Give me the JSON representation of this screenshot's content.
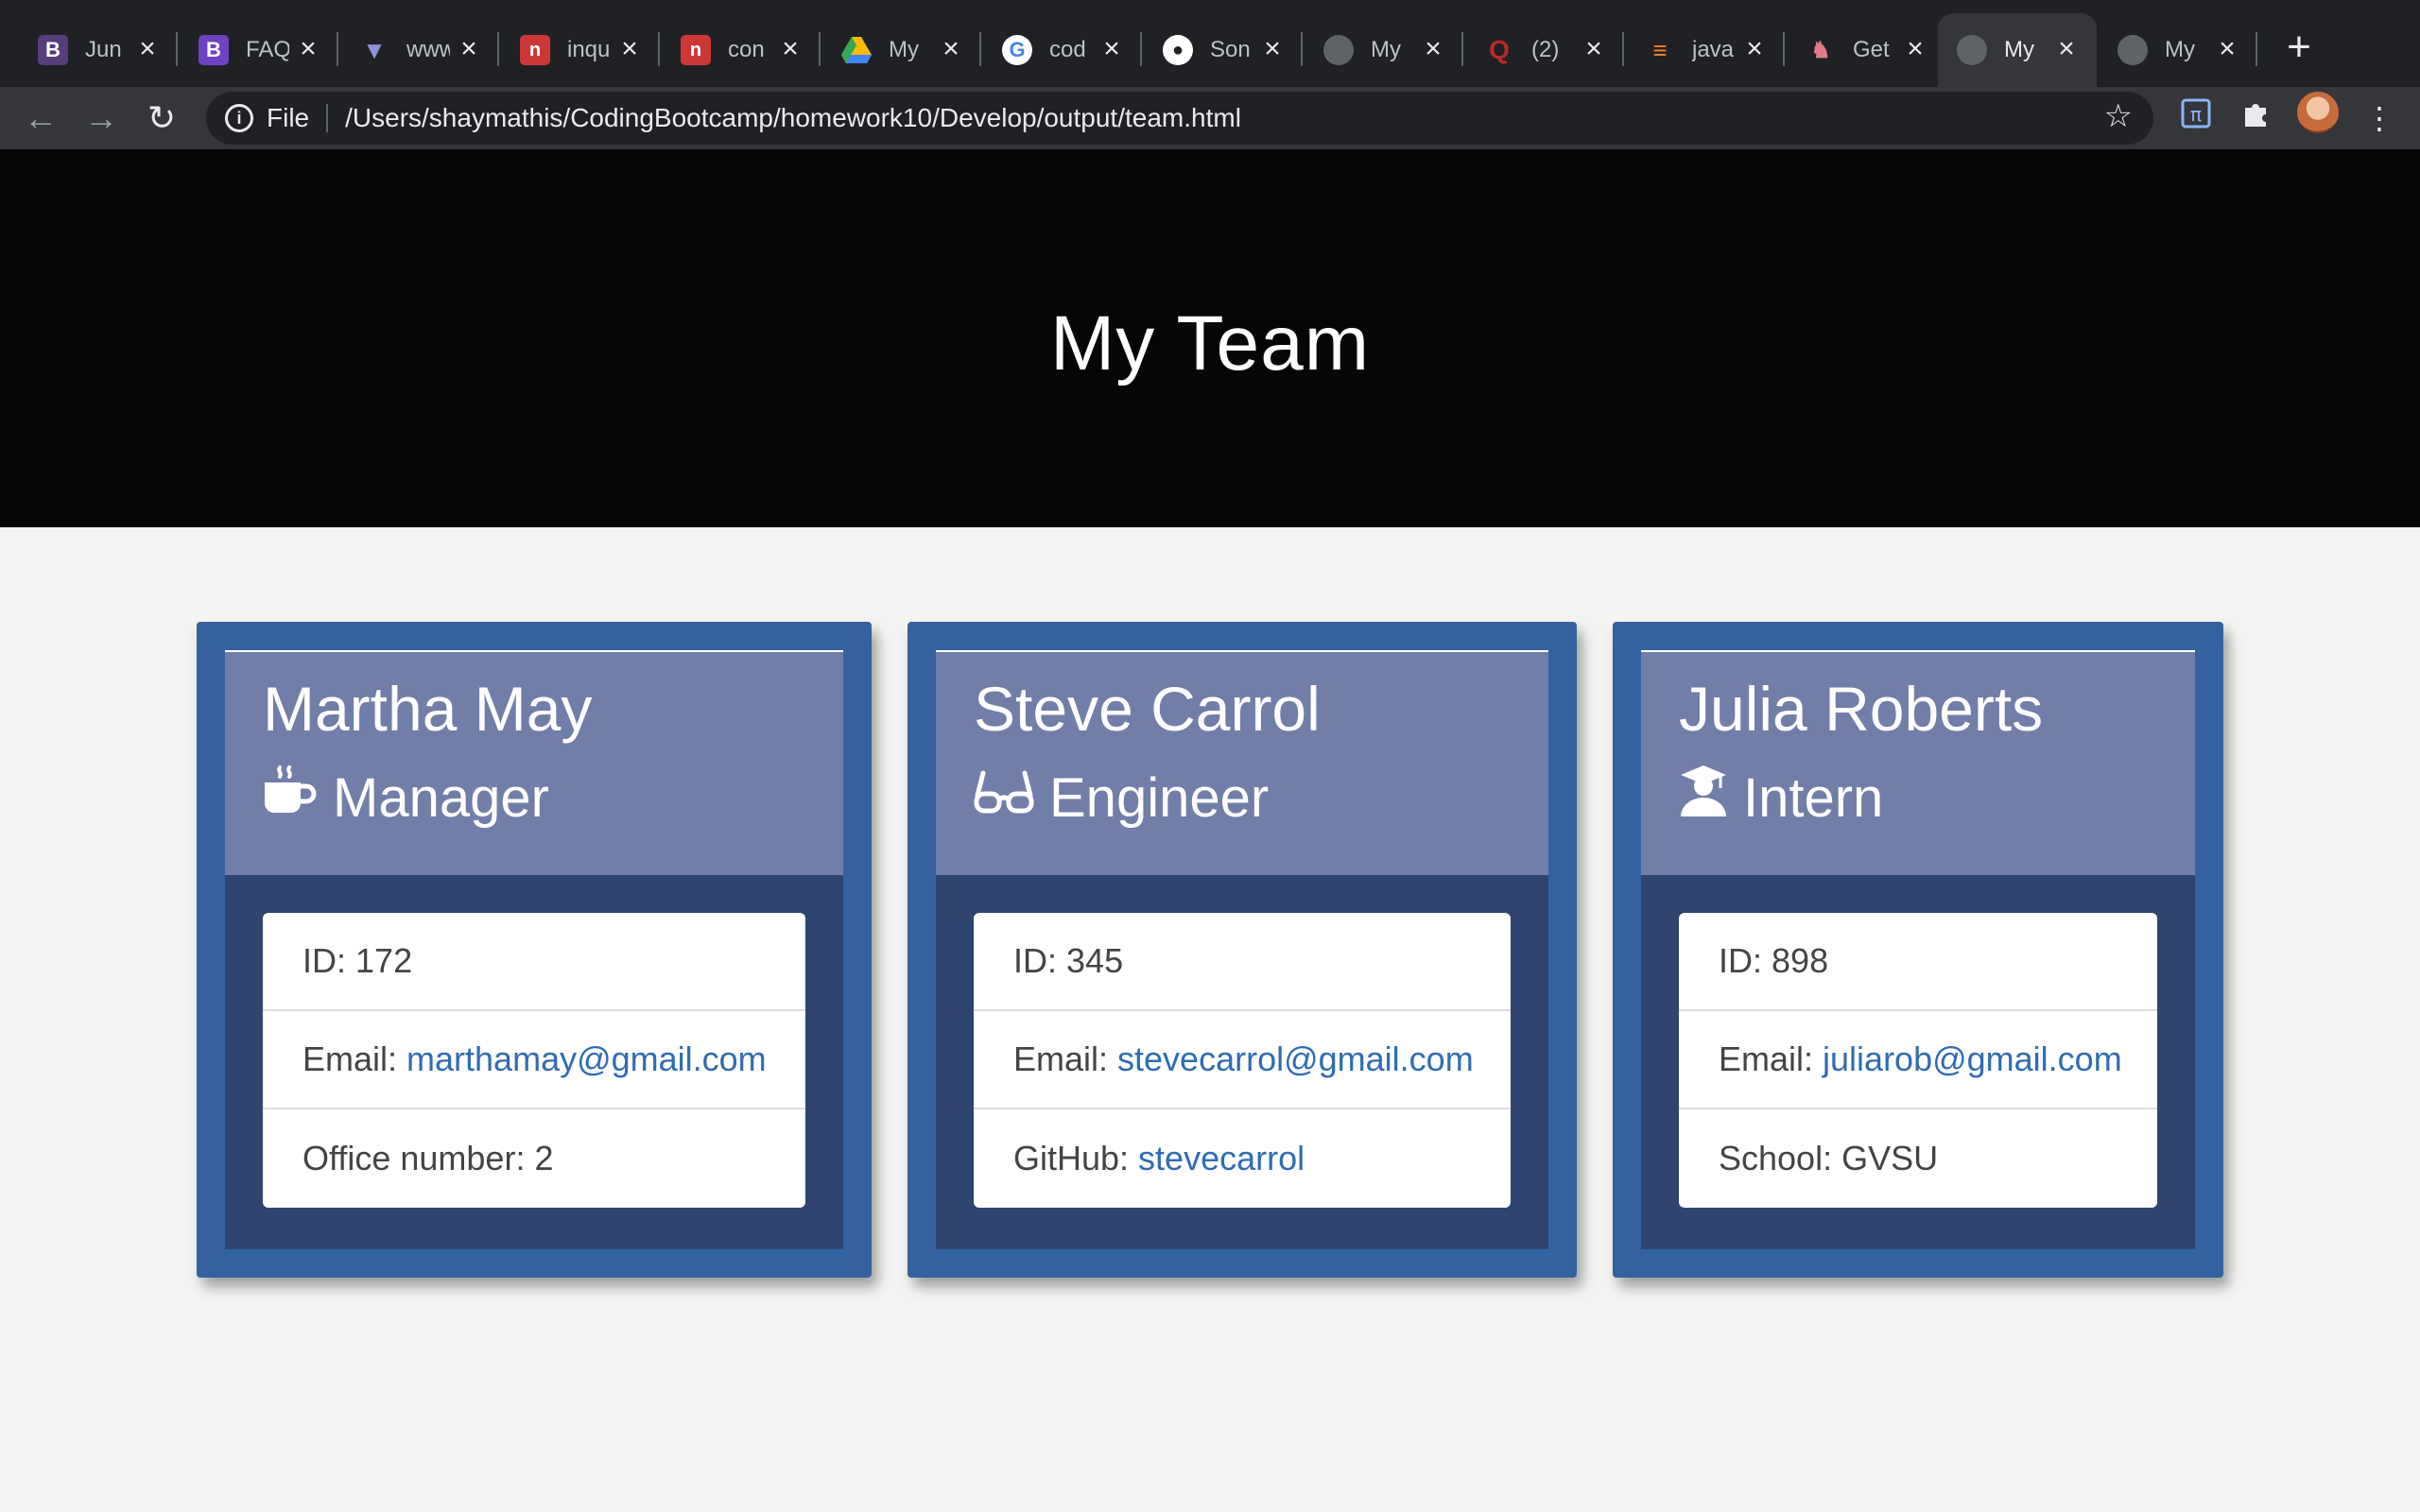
{
  "browser": {
    "tabs": [
      {
        "title": "Jun",
        "icon": "bootstrap-icon",
        "color": "#563d7c"
      },
      {
        "title": "FAQ",
        "icon": "bootstrap-icon",
        "color": "#6f42c1"
      },
      {
        "title": "www",
        "icon": "wolf-icon",
        "color": "#6b6fb5"
      },
      {
        "title": "inqu",
        "icon": "npm-icon",
        "color": "#cb3837"
      },
      {
        "title": "con",
        "icon": "npm-icon",
        "color": "#cb3837"
      },
      {
        "title": "My",
        "icon": "google-drive-icon",
        "color": "#fbbc04"
      },
      {
        "title": "cod",
        "icon": "google-icon",
        "color": "#ffffff"
      },
      {
        "title": "Son",
        "icon": "github-icon",
        "color": "#ffffff"
      },
      {
        "title": "My",
        "icon": "globe-icon",
        "color": "#5f6368"
      },
      {
        "title": "(2)",
        "icon": "quora-icon",
        "color": "#b92b27"
      },
      {
        "title": "java",
        "icon": "stackoverflow-icon",
        "color": "#f48024"
      },
      {
        "title": "Get",
        "icon": "jest-icon",
        "color": "#c21325"
      },
      {
        "title": "My",
        "icon": "globe-icon",
        "color": "#5f6368",
        "active": true
      },
      {
        "title": "My",
        "icon": "globe-icon",
        "color": "#5f6368"
      }
    ],
    "address": {
      "scheme": "File",
      "url": "/Users/shaymathis/CodingBootcamp/homework10/Develop/output/team.html"
    }
  },
  "page": {
    "title": "My Team",
    "colors": {
      "card": "#3462a0",
      "card_head": "#717ea8",
      "card_body": "#2f456f",
      "link": "#2f6cb3"
    }
  },
  "team": [
    {
      "name": "Martha May",
      "role": "Manager",
      "role_icon": "coffee-mug-icon",
      "id_label": "ID:",
      "id": "172",
      "email_label": "Email:",
      "email": "marthamay@gmail.com",
      "extra_label": "Office number:",
      "extra": "2"
    },
    {
      "name": "Steve Carrol",
      "role": "Engineer",
      "role_icon": "glasses-icon",
      "id_label": "ID:",
      "id": "345",
      "email_label": "Email:",
      "email": "stevecarrol@gmail.com",
      "extra_label": "GitHub:",
      "extra": "stevecarrol"
    },
    {
      "name": "Julia Roberts",
      "role": "Intern",
      "role_icon": "graduate-icon",
      "id_label": "ID:",
      "id": "898",
      "email_label": "Email:",
      "email": "juliarob@gmail.com",
      "extra_label": "School:",
      "extra": "GVSU"
    }
  ]
}
